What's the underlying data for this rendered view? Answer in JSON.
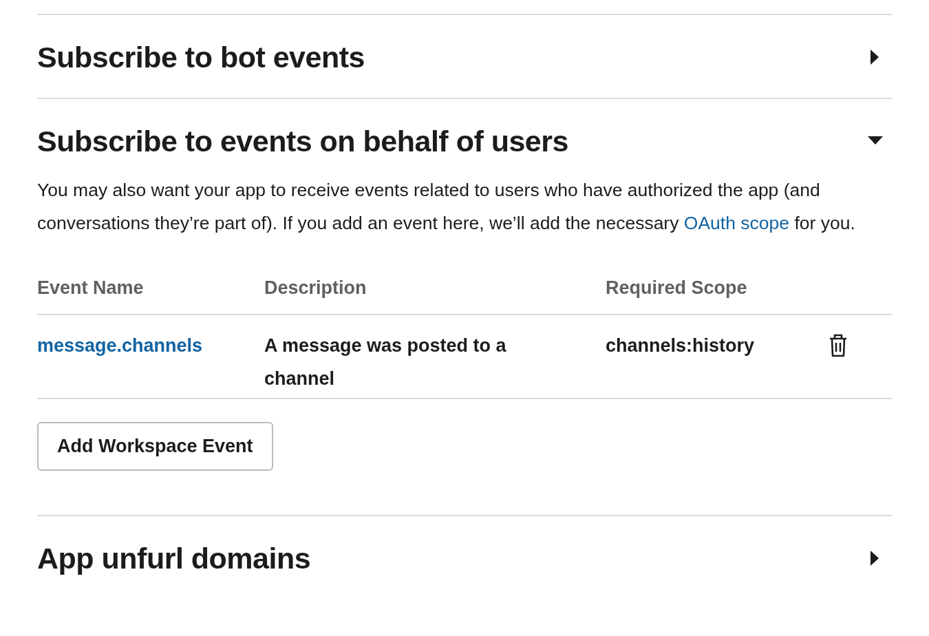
{
  "sections": [
    {
      "title": "Subscribe to bot events",
      "expanded": false
    },
    {
      "title": "Subscribe to events on behalf of users",
      "expanded": true,
      "description": {
        "before": "You may also want your app to receive events related to users who have authorized the app (and conversations they’re part of). If you add an event here, we’ll add the necessary",
        "link": "OAuth scope",
        "after": "for you."
      },
      "table": {
        "columns": [
          "Event Name",
          "Description",
          "Required Scope"
        ],
        "rows": [
          {
            "event": "message.channels",
            "description": "A message was posted to a channel",
            "scope": "channels:history"
          }
        ]
      },
      "button": "Add Workspace Event"
    },
    {
      "title": "App unfurl domains",
      "expanded": false
    }
  ]
}
